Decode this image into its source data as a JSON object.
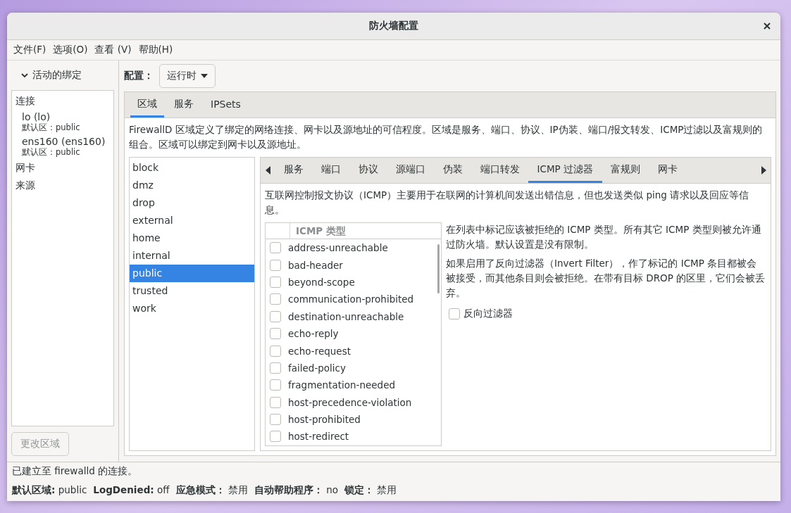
{
  "window": {
    "title": "防火墙配置"
  },
  "menu": [
    "文件(F)",
    "选项(O)",
    "查看 (V)",
    "帮助(H)"
  ],
  "sidebar": {
    "header": "活动的绑定",
    "expanded": true,
    "sections": [
      {
        "label": "连接",
        "children": [
          {
            "name": "lo (lo)",
            "zone": "默认区：public"
          },
          {
            "name": "ens160 (ens160)",
            "zone": "默认区：public"
          }
        ]
      },
      {
        "label": "网卡"
      },
      {
        "label": "来源"
      }
    ],
    "button": {
      "label": "更改区域",
      "disabled": true
    }
  },
  "config": {
    "label": "配置：",
    "value": "运行时"
  },
  "main_tabs": [
    {
      "label": "区域",
      "selected": true
    },
    {
      "label": "服务",
      "selected": false
    },
    {
      "label": "IPSets",
      "selected": false
    }
  ],
  "zones_description": "FirewallD 区域定义了绑定的网络连接、网卡以及源地址的可信程度。区域是服务、端口、协议、IP伪装、端口/报文转发、ICMP过滤以及富规则的组合。区域可以绑定到网卡以及源地址。",
  "zones": [
    {
      "name": "block",
      "selected": false
    },
    {
      "name": "dmz",
      "selected": false
    },
    {
      "name": "drop",
      "selected": false
    },
    {
      "name": "external",
      "selected": false
    },
    {
      "name": "home",
      "selected": false
    },
    {
      "name": "internal",
      "selected": false
    },
    {
      "name": "public",
      "selected": true
    },
    {
      "name": "trusted",
      "selected": false
    },
    {
      "name": "work",
      "selected": false
    }
  ],
  "zone_tabs": [
    {
      "label": "服务",
      "selected": false
    },
    {
      "label": "端口",
      "selected": false
    },
    {
      "label": "协议",
      "selected": false
    },
    {
      "label": "源端口",
      "selected": false
    },
    {
      "label": "伪装",
      "selected": false
    },
    {
      "label": "端口转发",
      "selected": false
    },
    {
      "label": "ICMP 过滤器",
      "selected": true
    },
    {
      "label": "富规则",
      "selected": false
    },
    {
      "label": "网卡",
      "selected": false
    }
  ],
  "icmp": {
    "description": "互联网控制报文协议（ICMP）主要用于在联网的计算机间发送出错信息，但也发送类似 ping 请求以及回应等信息。",
    "column": "ICMP 类型",
    "types": [
      {
        "name": "address-unreachable",
        "checked": false
      },
      {
        "name": "bad-header",
        "checked": false
      },
      {
        "name": "beyond-scope",
        "checked": false
      },
      {
        "name": "communication-prohibited",
        "checked": false
      },
      {
        "name": "destination-unreachable",
        "checked": false
      },
      {
        "name": "echo-reply",
        "checked": false
      },
      {
        "name": "echo-request",
        "checked": false
      },
      {
        "name": "failed-policy",
        "checked": false
      },
      {
        "name": "fragmentation-needed",
        "checked": false
      },
      {
        "name": "host-precedence-violation",
        "checked": false
      },
      {
        "name": "host-prohibited",
        "checked": false
      },
      {
        "name": "host-redirect",
        "checked": false
      }
    ],
    "help": [
      "在列表中标记应该被拒绝的 ICMP 类型。所有其它 ICMP 类型则被允许通过防火墙。默认设置是没有限制。",
      "如果启用了反向过滤器（Invert Filter），作了标记的 ICMP 条目都被会被接受，而其他条目则会被拒绝。在带有目标 DROP 的区里，它们会被丢弃。"
    ],
    "invert_filter": {
      "label": "反向过滤器",
      "checked": false
    }
  },
  "status": {
    "message": "已建立至 firewalld 的连接。",
    "items": [
      {
        "label": "默认区域:",
        "value": "public"
      },
      {
        "label": "LogDenied:",
        "value": "off"
      },
      {
        "label": "应急模式：",
        "value": "禁用"
      },
      {
        "label": "自动帮助程序：",
        "value": "no"
      },
      {
        "label": "锁定：",
        "value": "禁用"
      }
    ]
  }
}
